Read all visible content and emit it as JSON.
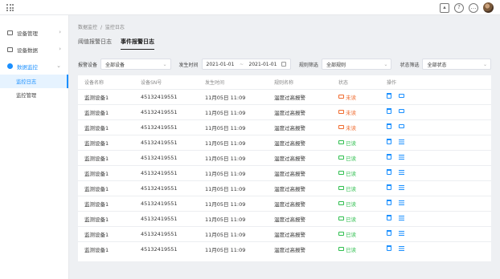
{
  "topbar": {
    "icons": [
      "apps-grid-icon",
      "chart-icon",
      "help-icon",
      "chat-icon",
      "user-avatar"
    ],
    "help_glyph": "?",
    "chat_glyph": "…"
  },
  "sidebar": {
    "groups": [
      {
        "label": "设备管理",
        "icon": "device-icon"
      },
      {
        "label": "设备数据",
        "icon": "data-icon"
      },
      {
        "label": "数据监控",
        "icon": "monitor-icon",
        "active": true
      }
    ],
    "sub_items": [
      {
        "label": "监控日志",
        "active": true
      },
      {
        "label": "监控管理"
      }
    ]
  },
  "breadcrumb": {
    "parent": "数据监控",
    "current": "监控日志",
    "separator": "/"
  },
  "tabs": [
    {
      "label": "阈值报警日志"
    },
    {
      "label": "事件报警日志",
      "active": true
    }
  ],
  "filters": {
    "alarm_device_label": "报警设备",
    "alarm_device_value": "全部设备",
    "time_label": "发生时间",
    "date_start": "2021-01-01",
    "date_to": "~",
    "date_end": "2021-01-01",
    "rule_label": "规则筛选",
    "rule_value": "全部规则",
    "status_label": "状态筛选",
    "status_value": "全部状态"
  },
  "table": {
    "headers": [
      "设备名称",
      "设备SN号",
      "发生时间",
      "规则名称",
      "状态",
      "操作"
    ],
    "rows": [
      {
        "name": "监测设备1",
        "sn": "45132419551",
        "time": "11月05日 11:09",
        "rule": "温度过高报警",
        "status": "未读",
        "read": false
      },
      {
        "name": "监测设备1",
        "sn": "45132419551",
        "time": "11月05日 11:09",
        "rule": "温度过高报警",
        "status": "未读",
        "read": false
      },
      {
        "name": "监测设备1",
        "sn": "45132419551",
        "time": "11月05日 11:09",
        "rule": "温度过高报警",
        "status": "未读",
        "read": false
      },
      {
        "name": "监测设备1",
        "sn": "45132419551",
        "time": "11月05日 11:09",
        "rule": "温度过高报警",
        "status": "已读",
        "read": true
      },
      {
        "name": "监测设备1",
        "sn": "45132419551",
        "time": "11月05日 11:09",
        "rule": "温度过高报警",
        "status": "已读",
        "read": true
      },
      {
        "name": "监测设备1",
        "sn": "45132419551",
        "time": "11月05日 11:09",
        "rule": "温度过高报警",
        "status": "已读",
        "read": true
      },
      {
        "name": "监测设备1",
        "sn": "45132419551",
        "time": "11月05日 11:09",
        "rule": "温度过高报警",
        "status": "已读",
        "read": true
      },
      {
        "name": "监测设备1",
        "sn": "45132419551",
        "time": "11月05日 11:09",
        "rule": "温度过高报警",
        "status": "已读",
        "read": true
      },
      {
        "name": "监测设备1",
        "sn": "45132419551",
        "time": "11月05日 11:09",
        "rule": "温度过高报警",
        "status": "已读",
        "read": true
      },
      {
        "name": "监测设备1",
        "sn": "45132419551",
        "time": "11月05日 11:09",
        "rule": "温度过高报警",
        "status": "已读",
        "read": true
      },
      {
        "name": "监测设备1",
        "sn": "45132419551",
        "time": "11月05日 11:09",
        "rule": "温度过高报警",
        "status": "已读",
        "read": true
      }
    ]
  },
  "colors": {
    "accent": "#1a8fff",
    "unread": "#f06b2e",
    "read": "#2fbf4f"
  }
}
